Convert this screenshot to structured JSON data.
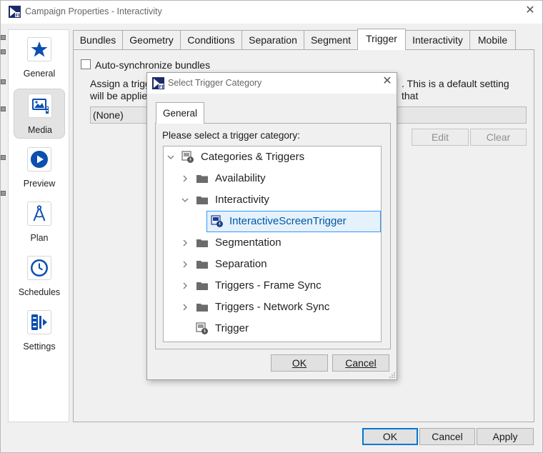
{
  "window": {
    "title": "Campaign Properties - Interactivity"
  },
  "sidebar": {
    "items": [
      {
        "label": "General",
        "icon": "star-icon"
      },
      {
        "label": "Media",
        "icon": "media-icon",
        "selected": true
      },
      {
        "label": "Preview",
        "icon": "play-icon"
      },
      {
        "label": "Plan",
        "icon": "compass-icon"
      },
      {
        "label": "Schedules",
        "icon": "clock-icon"
      },
      {
        "label": "Settings",
        "icon": "settings-icon"
      }
    ]
  },
  "tabs": [
    "Bundles",
    "Geometry",
    "Conditions",
    "Separation",
    "Segment",
    "Trigger",
    "Interactivity",
    "Mobile"
  ],
  "active_tab": "Trigger",
  "trigger_panel": {
    "auto_sync_label": "Auto-synchronize bundles",
    "assign_text_left": "Assign a trigg",
    "assign_text_right": ". This is a default setting that",
    "assign_text_line2": "will be applied",
    "combo_value": "(None)",
    "edit_label": "Edit",
    "clear_label": "Clear"
  },
  "dialog": {
    "title": "Select Trigger Category",
    "tab_label": "General",
    "prompt": "Please select a trigger category:",
    "tree": {
      "root": "Categories & Triggers",
      "items": [
        {
          "label": "Availability"
        },
        {
          "label": "Interactivity",
          "expanded": true
        },
        {
          "label": "InteractiveScreenTrigger",
          "selected": true
        },
        {
          "label": "Segmentation"
        },
        {
          "label": "Separation"
        },
        {
          "label": "Triggers - Frame Sync"
        },
        {
          "label": "Triggers - Network Sync"
        },
        {
          "label": "Trigger"
        }
      ]
    },
    "ok_label": "OK",
    "cancel_label": "Cancel"
  },
  "footer": {
    "ok_label": "OK",
    "cancel_label": "Cancel",
    "apply_label": "Apply"
  },
  "colors": {
    "accent_blue": "#0b4fb0",
    "selection_border": "#3399ff",
    "selection_bg": "#e5f1fb"
  }
}
